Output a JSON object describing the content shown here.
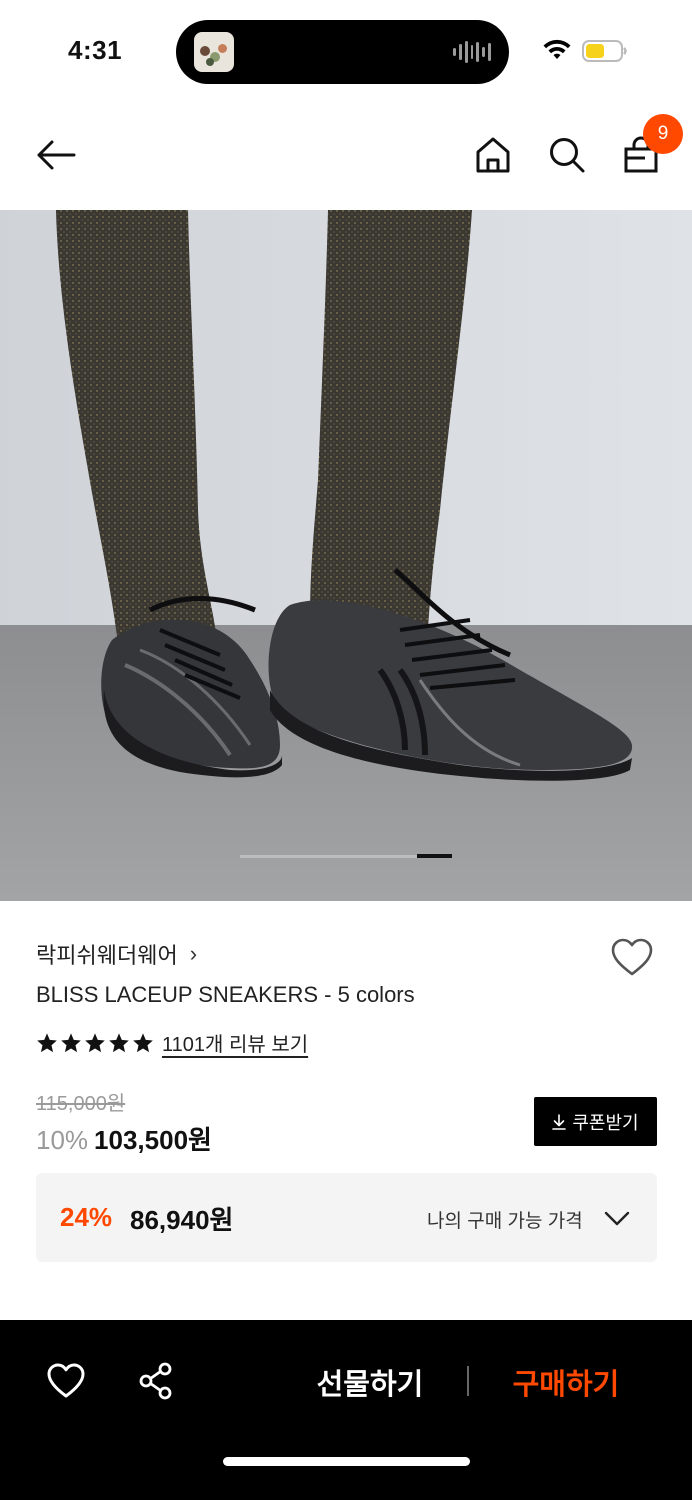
{
  "status_bar": {
    "time": "4:31"
  },
  "nav": {
    "cart_count": "9",
    "icons": [
      "back-arrow-icon",
      "home-icon",
      "search-icon",
      "shopping-bag-icon"
    ]
  },
  "product": {
    "brand": "락피쉬웨더웨어",
    "brand_chevron": "›",
    "title": "BLISS LACEUP SNEAKERS - 5 colors",
    "rating_stars": 5,
    "review_link": "1101개 리뷰 보기",
    "original_price": "115,000원",
    "discount_rate": "10%",
    "sale_price": "103,500원",
    "coupon_button": "쿠폰받기",
    "my_price": {
      "rate": "24%",
      "value": "86,940원",
      "label": "나의 구매 가능 가격"
    },
    "image_carousel": {
      "current_index": 5,
      "total": 5
    }
  },
  "bottom_bar": {
    "gift_label": "선물하기",
    "buy_label": "구매하기"
  },
  "colors": {
    "accent": "#ff4800",
    "bottom_bar_bg": "#000000",
    "coupon_bg": "#000000",
    "my_price_bg": "#f4f4f4"
  }
}
